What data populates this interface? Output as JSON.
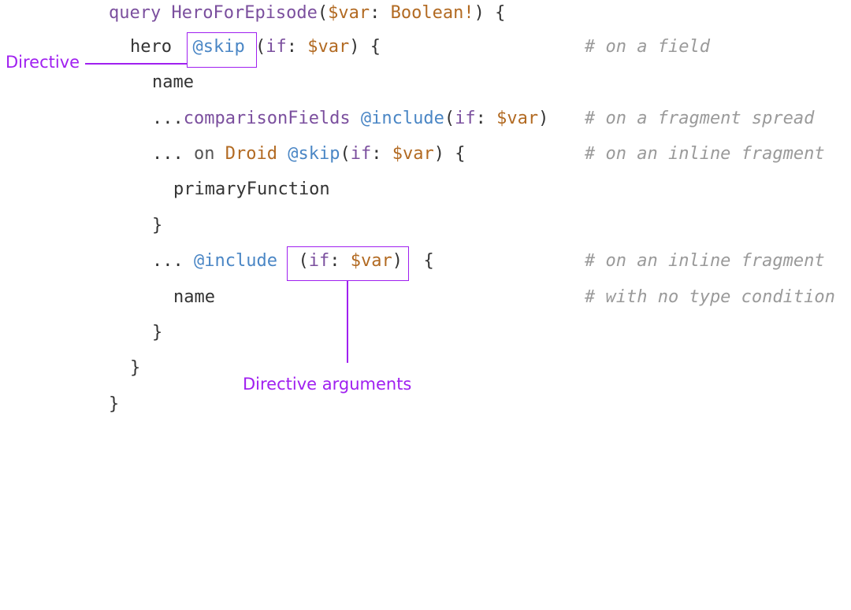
{
  "code": {
    "line1": {
      "kw": "query",
      "name": "HeroForEpisode",
      "open": "(",
      "var": "$var",
      "colon": ": ",
      "type": "Boolean!",
      "close": ") {"
    },
    "line2": {
      "field": "hero",
      "directive": "@skip",
      "open": "(",
      "arg": "if",
      "colon": ": ",
      "var": "$var",
      "close": ") {"
    },
    "line3": {
      "field": "name"
    },
    "line4": {
      "spread": "...",
      "fragment": "comparisonFields",
      "directive": "@include",
      "open": "(",
      "arg": "if",
      "colon": ": ",
      "var": "$var",
      "close": ")"
    },
    "line5": {
      "spread": "...",
      "on": "on",
      "type": "Droid",
      "directive": "@skip",
      "open": "(",
      "arg": "if",
      "colon": ": ",
      "var": "$var",
      "close": ") {"
    },
    "line6": {
      "field": "primaryFunction"
    },
    "line7": {
      "brace": "}"
    },
    "line8": {
      "spread": "...",
      "directive": "@include",
      "open": "(",
      "arg": "if",
      "colon": ": ",
      "var": "$var",
      "close": ")",
      "brace": "{"
    },
    "line9": {
      "field": "name"
    },
    "line10": {
      "brace": "}"
    },
    "line11": {
      "brace": "}"
    },
    "line12": {
      "brace": "}"
    }
  },
  "comments": {
    "c1": "# on a field",
    "c2": "# on a fragment spread",
    "c3": "# on an inline fragment",
    "c4": "# on an inline fragment",
    "c5": "# with no type condition"
  },
  "annotations": {
    "directive": "Directive",
    "directive_arguments": "Directive arguments"
  },
  "colors": {
    "annotation": "#a020f0",
    "keyword": "#7b4f9e",
    "variable": "#b26a22",
    "directive": "#4a86c5",
    "comment": "#9a9a9a",
    "text": "#333333"
  }
}
